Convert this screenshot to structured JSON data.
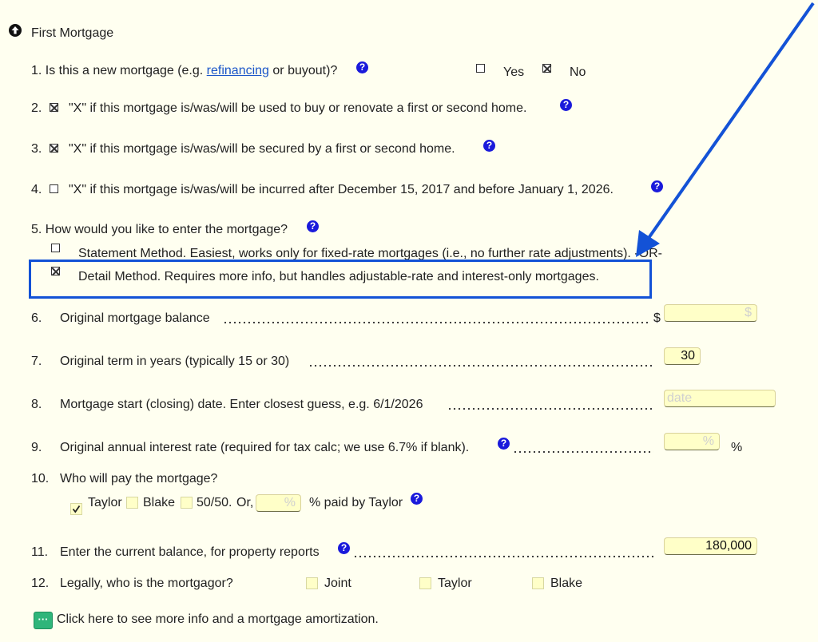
{
  "section": {
    "title": "First Mortgage"
  },
  "q1": {
    "text": "1. Is this a new mortgage (e.g.",
    "link": "refinancing",
    "text_after": "or buyout)?",
    "yes": "Yes",
    "no": "No"
  },
  "q2": {
    "prefix": "2.",
    "text": "\"X\" if this mortgage is/was/will be used to buy or renovate a first or second home."
  },
  "q3": {
    "prefix": "3.",
    "text": "\"X\" if this mortgage is/was/will be secured by a first or second home."
  },
  "q4": {
    "prefix": "4.",
    "text": "\"X\" if this mortgage is/was/will be incurred after December 15, 2017 and before January 1, 2026."
  },
  "q5": {
    "text": "5. How would you like to enter the mortgage?",
    "opt1": "Statement Method. Easiest, works only for fixed-rate mortgages (i.e., no further rate adjustments). -OR-",
    "opt2": "Detail Method. Requires more info, but handles adjustable-rate and interest-only mortgages."
  },
  "q6": {
    "num": "6.",
    "text": "Original mortgage balance",
    "currency": "$",
    "placeholder": "$",
    "value": ""
  },
  "q7": {
    "num": "7.",
    "text": "Original term in years (typically 15 or 30)",
    "value": "30"
  },
  "q8": {
    "num": "8.",
    "text": "Mortgage start (closing) date. Enter closest guess, e.g. 6/1/2026",
    "placeholder": "date"
  },
  "q9": {
    "num": "9.",
    "text": "Original annual interest rate (required for tax calc; we use 6.7% if blank).",
    "placeholder": "%",
    "suffix": "%"
  },
  "q10": {
    "num": "10.",
    "text": "Who will pay the mortgage?",
    "opt_taylor": "Taylor",
    "opt_blake": "Blake",
    "opt_5050": "50/50.",
    "or": "Or,",
    "placeholder": "%",
    "suffix": "% paid by Taylor"
  },
  "q11": {
    "num": "11.",
    "text": "Enter the current balance, for property reports",
    "value": "180,000"
  },
  "q12": {
    "num": "12.",
    "text": "Legally, who is the mortgagor?",
    "opt_joint": "Joint",
    "opt_taylor": "Taylor",
    "opt_blake": "Blake"
  },
  "footer": {
    "button_icon": "···",
    "text": "Click here to see more info and a mortgage amortization."
  },
  "help_glyph": "?",
  "checks": {
    "q1_yes": false,
    "q1_no": true,
    "q2": true,
    "q3": true,
    "q4": false,
    "q5_statement": false,
    "q5_detail": true,
    "q10_taylor": true
  }
}
